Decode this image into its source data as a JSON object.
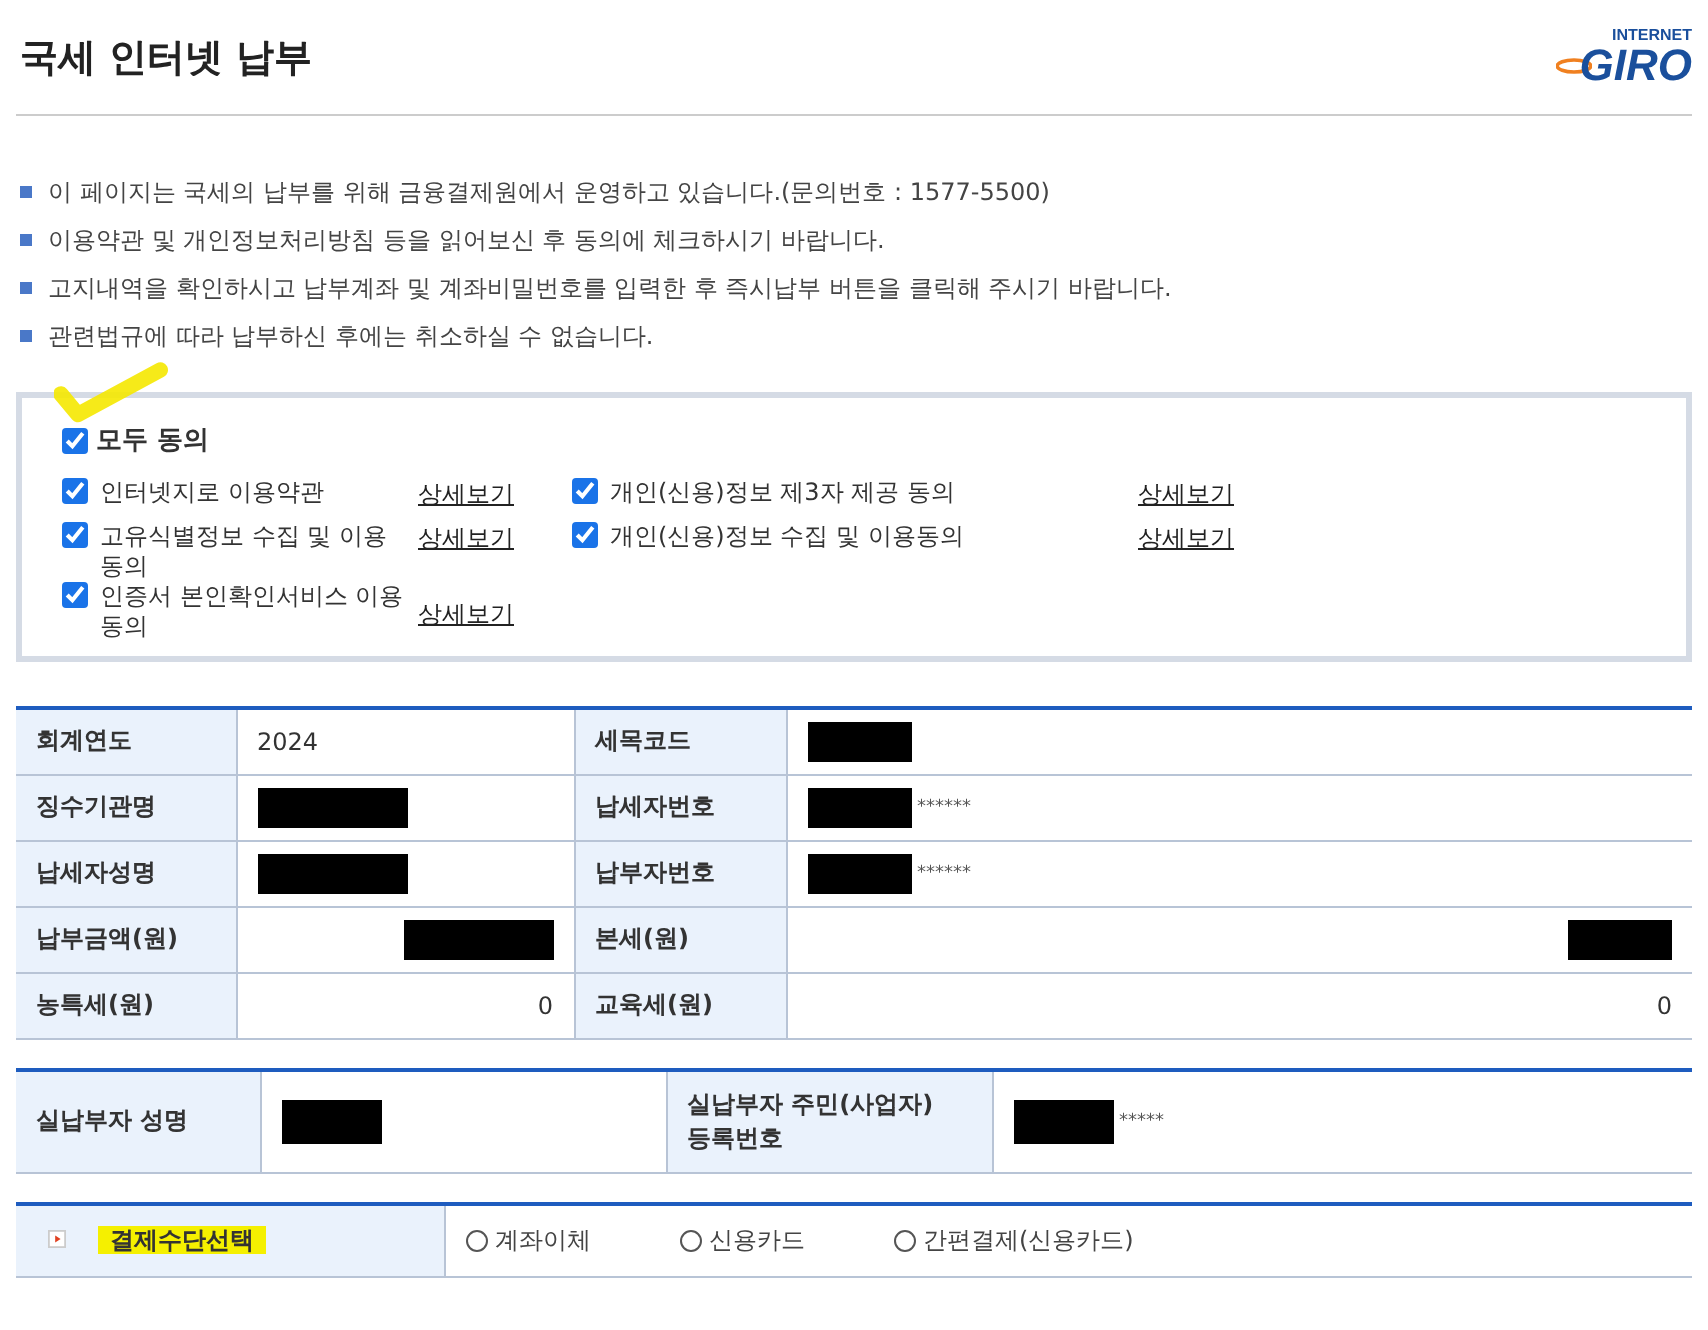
{
  "header": {
    "title": "국세 인터넷 납부",
    "logo_small": "INTERNET",
    "logo_large": "GIRO"
  },
  "notices": [
    "이 페이지는 국세의 납부를 위해 금융결제원에서 운영하고 있습니다.(문의번호 : 1577-5500)",
    "이용약관 및 개인정보처리방침 등을 읽어보신 후 동의에 체크하시기 바랍니다.",
    "고지내역을 확인하시고 납부계좌 및 계좌비밀번호를 입력한 후 즉시납부 버튼을 클릭해 주시기 바랍니다.",
    "관련법규에 따라 납부하신 후에는 취소하실 수 없습니다."
  ],
  "agreement": {
    "agree_all": {
      "label": "모두 동의",
      "checked": true,
      "annotated": true
    },
    "columns": [
      [
        {
          "label": "인터넷지로 이용약관",
          "checked": true,
          "link": "상세보기"
        },
        {
          "label": "고유식별정보 수집 및 이용동의",
          "checked": true,
          "link": "상세보기"
        },
        {
          "label": "인증서 본인확인서비스 이용동의",
          "checked": true,
          "link": "상세보기"
        }
      ],
      [
        {
          "label": "개인(신용)정보 제3자 제공 동의",
          "checked": true,
          "link": "상세보기"
        },
        {
          "label": "개인(신용)정보 수집 및 이용동의",
          "checked": true,
          "link": "상세보기"
        }
      ]
    ]
  },
  "tax_table": {
    "rows": [
      {
        "kind": "text",
        "cells": [
          {
            "label": "회계연도",
            "value": "2024"
          },
          {
            "label": "세목코드",
            "redacted": true
          }
        ]
      },
      {
        "kind": "text",
        "cells": [
          {
            "label": "징수기관명",
            "redacted": true
          },
          {
            "label": "납세자번호",
            "redacted": true,
            "masked": "******"
          }
        ]
      },
      {
        "kind": "text",
        "cells": [
          {
            "label": "납세자성명",
            "redacted": true
          },
          {
            "label": "납부자번호",
            "redacted": true,
            "masked": "******"
          }
        ]
      },
      {
        "kind": "amount",
        "cells": [
          {
            "label": "납부금액(원)",
            "redacted": true
          },
          {
            "label": "본세(원)",
            "redacted": true
          }
        ]
      },
      {
        "kind": "amount",
        "cells": [
          {
            "label": "농특세(원)",
            "value": "0"
          },
          {
            "label": "교육세(원)",
            "value": "0"
          }
        ]
      }
    ]
  },
  "payer_table": [
    {
      "label": "실납부자 성명",
      "redacted": true
    },
    {
      "label": "실납부자 주민(사업자)\n등록번호",
      "redacted": true,
      "masked": "*****"
    }
  ],
  "payment": {
    "label": "결제수단선택",
    "highlighted": true,
    "options": [
      {
        "label": "계좌이체",
        "selected": false
      },
      {
        "label": "신용카드",
        "selected": false
      },
      {
        "label": "간편결제(신용카드)",
        "selected": false
      }
    ]
  }
}
